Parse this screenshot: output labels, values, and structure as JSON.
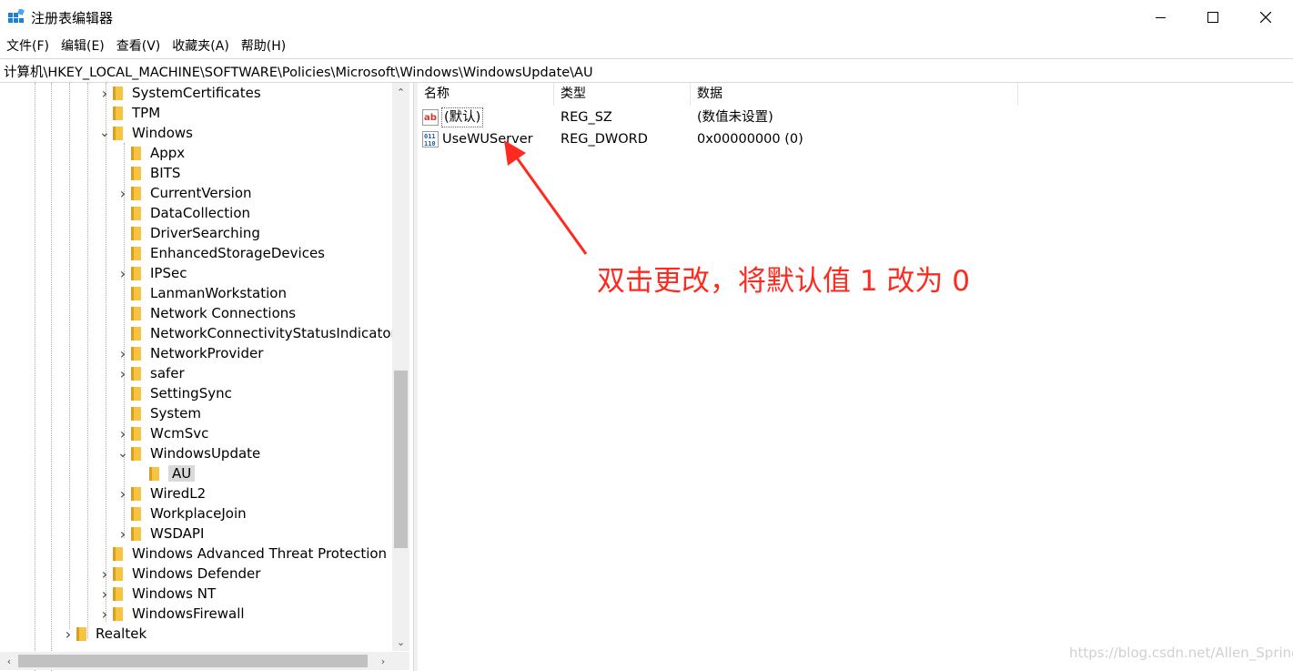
{
  "window": {
    "title": "注册表编辑器",
    "icon": "regedit-icon"
  },
  "menu": [
    "文件(F)",
    "编辑(E)",
    "查看(V)",
    "收藏夹(A)",
    "帮助(H)"
  ],
  "address": "计算机\\HKEY_LOCAL_MACHINE\\SOFTWARE\\Policies\\Microsoft\\Windows\\WindowsUpdate\\AU",
  "tree": [
    {
      "label": "SystemCertificates",
      "expander": "collapsed",
      "depth": 0
    },
    {
      "label": "TPM",
      "expander": "none",
      "depth": 0
    },
    {
      "label": "Windows",
      "expander": "expanded",
      "depth": 0
    },
    {
      "label": "Appx",
      "expander": "none",
      "depth": 1
    },
    {
      "label": "BITS",
      "expander": "none",
      "depth": 1
    },
    {
      "label": "CurrentVersion",
      "expander": "collapsed",
      "depth": 1
    },
    {
      "label": "DataCollection",
      "expander": "none",
      "depth": 1
    },
    {
      "label": "DriverSearching",
      "expander": "none",
      "depth": 1
    },
    {
      "label": "EnhancedStorageDevices",
      "expander": "none",
      "depth": 1
    },
    {
      "label": "IPSec",
      "expander": "collapsed",
      "depth": 1
    },
    {
      "label": "LanmanWorkstation",
      "expander": "none",
      "depth": 1
    },
    {
      "label": "Network Connections",
      "expander": "none",
      "depth": 1
    },
    {
      "label": "NetworkConnectivityStatusIndicator",
      "expander": "none",
      "depth": 1
    },
    {
      "label": "NetworkProvider",
      "expander": "collapsed",
      "depth": 1
    },
    {
      "label": "safer",
      "expander": "collapsed",
      "depth": 1
    },
    {
      "label": "SettingSync",
      "expander": "none",
      "depth": 1
    },
    {
      "label": "System",
      "expander": "none",
      "depth": 1
    },
    {
      "label": "WcmSvc",
      "expander": "collapsed",
      "depth": 1
    },
    {
      "label": "WindowsUpdate",
      "expander": "expanded",
      "depth": 1
    },
    {
      "label": "AU",
      "expander": "none",
      "depth": 2,
      "selected": true
    },
    {
      "label": "WiredL2",
      "expander": "collapsed",
      "depth": 1
    },
    {
      "label": "WorkplaceJoin",
      "expander": "none",
      "depth": 1
    },
    {
      "label": "WSDAPI",
      "expander": "collapsed",
      "depth": 1
    },
    {
      "label": "Windows Advanced Threat Protection",
      "expander": "none",
      "depth": 0
    },
    {
      "label": "Windows Defender",
      "expander": "collapsed",
      "depth": 0
    },
    {
      "label": "Windows NT",
      "expander": "collapsed",
      "depth": 0
    },
    {
      "label": "WindowsFirewall",
      "expander": "collapsed",
      "depth": 0
    },
    {
      "label": "Realtek",
      "expander": "collapsed",
      "depth": -1
    }
  ],
  "columns": {
    "name": "名称",
    "type": "类型",
    "data": "数据"
  },
  "values": [
    {
      "name": "(默认)",
      "type": "REG_SZ",
      "data": "(数值未设置)",
      "icon": "string-value-icon"
    },
    {
      "name": "UseWUServer",
      "type": "REG_DWORD",
      "data": "0x00000000 (0)",
      "icon": "dword-value-icon"
    }
  ],
  "annotation": "双击更改，将默认值 1 改为 0",
  "annotation_color": "#ff2a1f",
  "watermark": "https://blog.csdn.net/Allen_Spring"
}
